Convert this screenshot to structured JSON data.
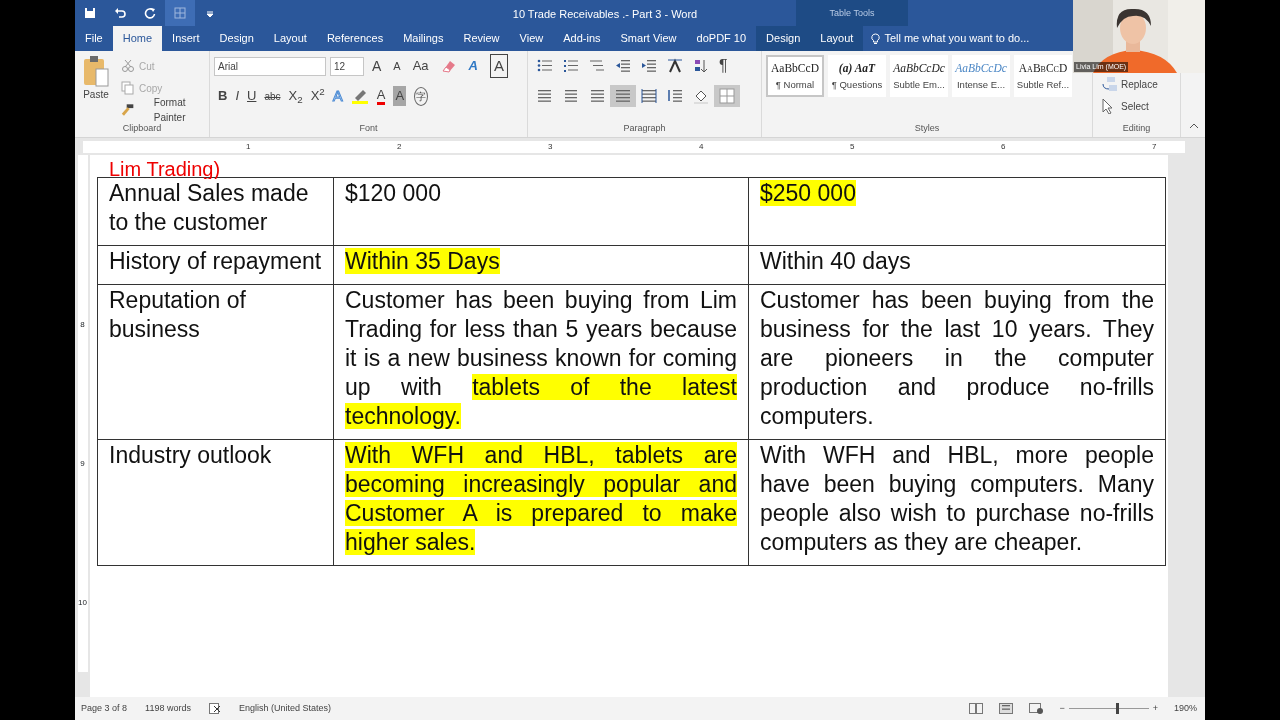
{
  "title_bar": {
    "quick_access": [
      {
        "kind": "save"
      },
      {
        "kind": "undo"
      },
      {
        "kind": "redo"
      },
      {
        "kind": "table"
      },
      {
        "kind": "customize"
      }
    ],
    "title": "10 Trade Receivables .- Part 3 - Word",
    "contextual_label": "Table Tools"
  },
  "tabs": [
    {
      "label": "File",
      "selected": false,
      "contextual": false
    },
    {
      "label": "Home",
      "selected": true,
      "contextual": false
    },
    {
      "label": "Insert",
      "selected": false,
      "contextual": false
    },
    {
      "label": "Design",
      "selected": false,
      "contextual": false
    },
    {
      "label": "Layout",
      "selected": false,
      "contextual": false
    },
    {
      "label": "References",
      "selected": false,
      "contextual": false
    },
    {
      "label": "Mailings",
      "selected": false,
      "contextual": false
    },
    {
      "label": "Review",
      "selected": false,
      "contextual": false
    },
    {
      "label": "View",
      "selected": false,
      "contextual": false
    },
    {
      "label": "Add-ins",
      "selected": false,
      "contextual": false
    },
    {
      "label": "Smart View",
      "selected": false,
      "contextual": false
    },
    {
      "label": "doPDF 10",
      "selected": false,
      "contextual": false
    },
    {
      "label": "Design",
      "selected": false,
      "contextual": true
    },
    {
      "label": "Layout",
      "selected": false,
      "contextual": true
    }
  ],
  "tell_me": {
    "placeholder": "Tell me what you want to do..."
  },
  "ribbon": {
    "clipboard": {
      "label": "Clipboard",
      "paste": "Paste",
      "items": [
        {
          "kind": "cut",
          "label": "Cut",
          "disabled": true
        },
        {
          "kind": "copy",
          "label": "Copy",
          "disabled": true
        },
        {
          "kind": "painter",
          "label": "Format Painter",
          "disabled": false
        }
      ]
    },
    "font": {
      "label": "Font",
      "font_name": "Arial",
      "font_size": "12",
      "row_1": [
        {
          "kind": "grow",
          "label": "A"
        },
        {
          "kind": "shrink",
          "label": "A"
        },
        {
          "kind": "case",
          "label": "Aa"
        },
        {
          "kind": "clear"
        },
        {
          "kind": "effects",
          "label": "A"
        },
        {
          "kind": "border",
          "label": "A"
        }
      ],
      "row_2": [
        {
          "kind": "bold",
          "label": "B"
        },
        {
          "kind": "italic",
          "label": "I"
        },
        {
          "kind": "underline",
          "label": "U"
        },
        {
          "kind": "strike",
          "label": "abc"
        },
        {
          "kind": "script",
          "label": "X$_{2}$"
        },
        {
          "kind": "script",
          "label": "X$^{2}$"
        },
        {
          "kind": "outline",
          "label": "A"
        },
        {
          "kind": "highlight"
        },
        {
          "kind": "color",
          "label": "A"
        },
        {
          "kind": "shading",
          "label": "A"
        },
        {
          "kind": "enclose",
          "label": "字"
        }
      ]
    },
    "paragraph": {
      "label": "Paragraph",
      "row_1": [
        {
          "kind": "bullets",
          "selected": false
        },
        {
          "kind": "numbering",
          "selected": false
        },
        {
          "kind": "multilevel",
          "selected": false
        },
        {
          "kind": "outdent",
          "selected": false
        },
        {
          "kind": "indent",
          "selected": false
        },
        {
          "kind": "asian",
          "selected": false
        },
        {
          "kind": "sort",
          "selected": false
        },
        {
          "kind": "pilcrow",
          "label": "¶",
          "selected": false
        }
      ],
      "row_2": [
        {
          "kind": "align-left",
          "selected": false
        },
        {
          "kind": "align-center",
          "selected": false
        },
        {
          "kind": "align-right",
          "selected": false
        },
        {
          "kind": "justify",
          "selected": true
        },
        {
          "kind": "distributed",
          "selected": false
        },
        {
          "kind": "spacing",
          "selected": false
        },
        {
          "kind": "shading",
          "selected": false
        },
        {
          "kind": "borders",
          "selected": true
        }
      ]
    },
    "styles": {
      "label": "Styles",
      "items": [
        {
          "kind": "plain",
          "preview": "AaBbCcD",
          "name": "¶ Normal",
          "selected": true
        },
        {
          "kind": "bold",
          "preview": "(a) AaT",
          "name": "¶ Questions",
          "selected": false
        },
        {
          "kind": "italic",
          "preview": "AaBbCcDc",
          "name": "Subtle Em...",
          "selected": false
        },
        {
          "kind": "accent",
          "preview": "AaBbCcDc",
          "name": "Intense E...",
          "selected": false
        },
        {
          "kind": "caps",
          "preview": "AaBbCcD",
          "name": "Subtle Ref...",
          "selected": false
        }
      ]
    },
    "editing": {
      "label": "Editing",
      "items": [
        {
          "kind": "replace",
          "label": "Replace"
        },
        {
          "kind": "select",
          "label": "Select"
        }
      ]
    }
  },
  "ruler": {
    "numbers": [
      "1",
      "2",
      "3",
      "4",
      "5",
      "6",
      "7"
    ]
  },
  "vertical_ruler": {
    "numbers": [
      "8",
      "9",
      "10"
    ]
  },
  "document": {
    "heading": "Lim Trading)",
    "table": {
      "rows": [
        [
          {
            "runs": [
              {
                "text": "Annual Sales made to the customer",
                "highlight": false
              }
            ]
          },
          {
            "runs": [
              {
                "text": "$120 000",
                "highlight": false
              }
            ]
          },
          {
            "runs": [
              {
                "text": "$250 000",
                "highlight": true
              }
            ]
          }
        ],
        [
          {
            "runs": [
              {
                "text": "History of repayment",
                "highlight": false
              }
            ]
          },
          {
            "runs": [
              {
                "text": "Within 35 Days",
                "highlight": true
              }
            ]
          },
          {
            "runs": [
              {
                "text": "Within 40 days",
                "highlight": false
              }
            ]
          }
        ],
        [
          {
            "runs": [
              {
                "text": "Reputation of business",
                "highlight": false
              }
            ]
          },
          {
            "runs": [
              {
                "text": "Customer has been buying from Lim Trading for less than 5 years because it is a new business known for coming up with ",
                "highlight": false
              },
              {
                "text": "tablets of the latest technology.",
                "highlight": true
              }
            ]
          },
          {
            "runs": [
              {
                "text": "Customer has been buying from the business for the last 10 years. They are pioneers in the computer production and produce no-frills computers.",
                "highlight": false
              }
            ]
          }
        ],
        [
          {
            "runs": [
              {
                "text": "Industry outlook",
                "highlight": false
              }
            ]
          },
          {
            "runs": [
              {
                "text": "With WFH and HBL, tablets are becoming increasingly popular and Customer A is prepared to make higher sales.",
                "highlight": true
              }
            ]
          },
          {
            "runs": [
              {
                "text": "With WFH and HBL, more people have been buying computers. Many people also wish to purchase no-frills computers as they are cheaper.",
                "highlight": false
              }
            ]
          }
        ]
      ]
    }
  },
  "status_bar": {
    "page": "Page 3 of 8",
    "words": "1198 words",
    "language": "English (United States)",
    "zoom": "190%",
    "zoom_out": "−",
    "zoom_in": "+",
    "zoom_slider": {
      "level": 0.62
    }
  },
  "video": {
    "kind": "picture",
    "name": "Livia Lim (MOE)"
  }
}
